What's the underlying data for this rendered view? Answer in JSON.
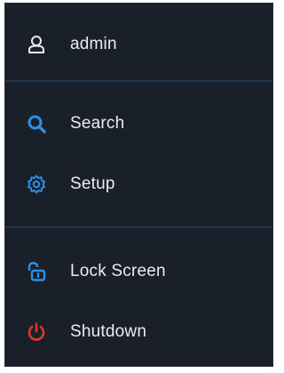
{
  "menu": {
    "user": {
      "label": "admin",
      "icon": "user-icon"
    },
    "items": [
      {
        "label": "Search",
        "icon": "search-icon",
        "color": "#2f8fe6"
      },
      {
        "label": "Setup",
        "icon": "gear-icon",
        "color": "#2f8fe6"
      }
    ],
    "system": [
      {
        "label": "Lock Screen",
        "icon": "unlock-icon",
        "color": "#2f8fe6"
      },
      {
        "label": "Shutdown",
        "icon": "power-icon",
        "color": "#e0352b"
      }
    ]
  },
  "colors": {
    "background": "#1a2029",
    "divider": "#22384f",
    "accent": "#2f8fe6",
    "danger": "#e0352b",
    "text": "#e9edf2"
  }
}
